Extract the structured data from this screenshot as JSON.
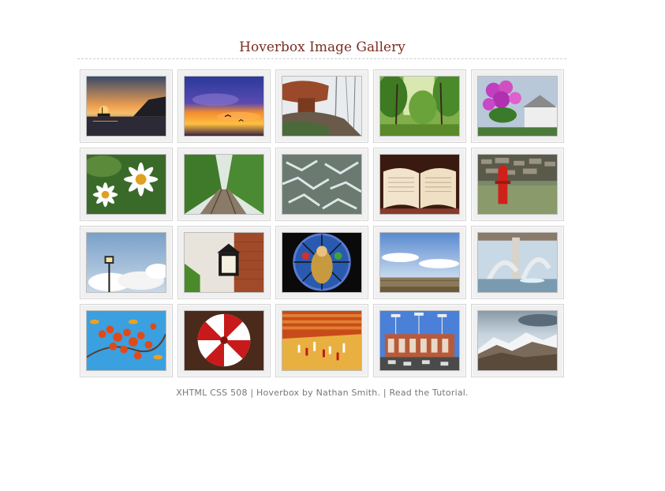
{
  "page": {
    "title": "Hoverbox Image Gallery"
  },
  "gallery": {
    "photos": [
      {
        "subject": "sunset-ship"
      },
      {
        "subject": "sunset-sky-birds"
      },
      {
        "subject": "rock-formation"
      },
      {
        "subject": "forest-trees"
      },
      {
        "subject": "flower-basket"
      },
      {
        "subject": "daisies"
      },
      {
        "subject": "railroad-track"
      },
      {
        "subject": "frosted-pine"
      },
      {
        "subject": "open-bible"
      },
      {
        "subject": "fire-hydrant"
      },
      {
        "subject": "lamp-post-clouds"
      },
      {
        "subject": "wall-lantern"
      },
      {
        "subject": "stained-glass-window"
      },
      {
        "subject": "open-field-sky"
      },
      {
        "subject": "fountain-sculpture"
      },
      {
        "subject": "orange-berries"
      },
      {
        "subject": "umbrella-ceiling"
      },
      {
        "subject": "basketball-game"
      },
      {
        "subject": "stadium-building"
      },
      {
        "subject": "snowy-mountain"
      }
    ]
  },
  "footer": {
    "xhtml": "XHTML",
    "css": "CSS",
    "section508": "508",
    "sep1": " | ",
    "hoverbox": "Hoverbox",
    "by": " by ",
    "author": "Nathan Smith",
    "period": ".",
    "sep2": " | ",
    "tutorial_prefix": "Read the ",
    "tutorial": "Tutorial",
    "tail": "."
  },
  "colors": {
    "title": "#7a2e20",
    "footer_text": "#777777",
    "tile_bg": "#f0f0f0",
    "tile_border": "#d4d4d4"
  }
}
